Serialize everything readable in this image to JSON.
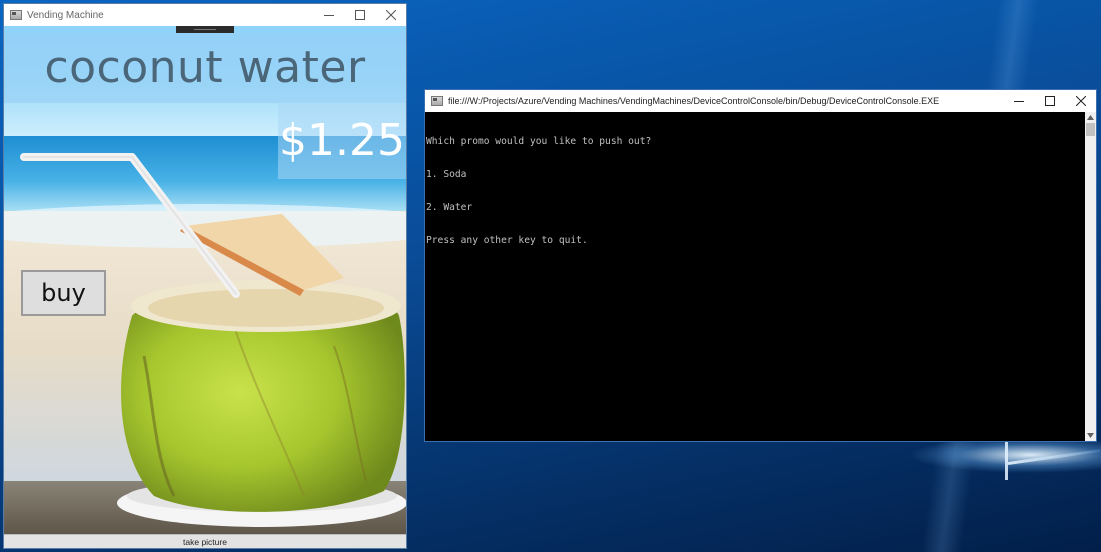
{
  "vending_window": {
    "title": "Vending Machine",
    "product_name": "coconut water",
    "price": "$1.25",
    "buy_label": "buy",
    "take_picture_label": "take picture"
  },
  "console_window": {
    "title": "file:///W:/Projects/Azure/Vending Machines/VendingMachines/DeviceControlConsole/bin/Debug/DeviceControlConsole.EXE",
    "lines": [
      "Which promo would you like to push out?",
      "1. Soda",
      "2. Water",
      "Press any other key to quit."
    ]
  },
  "icons": {
    "app_icon": "window-app-icon",
    "minimize": "minimize-icon",
    "maximize": "maximize-icon",
    "close": "close-icon",
    "scroll_up": "scroll-up-arrow-icon",
    "scroll_down": "scroll-down-arrow-icon"
  },
  "colors": {
    "desktop_blue": "#0857aa",
    "console_bg": "#000000",
    "console_text": "#c0c0c0",
    "price_text": "#ffffff",
    "product_text": "#4a6678"
  }
}
